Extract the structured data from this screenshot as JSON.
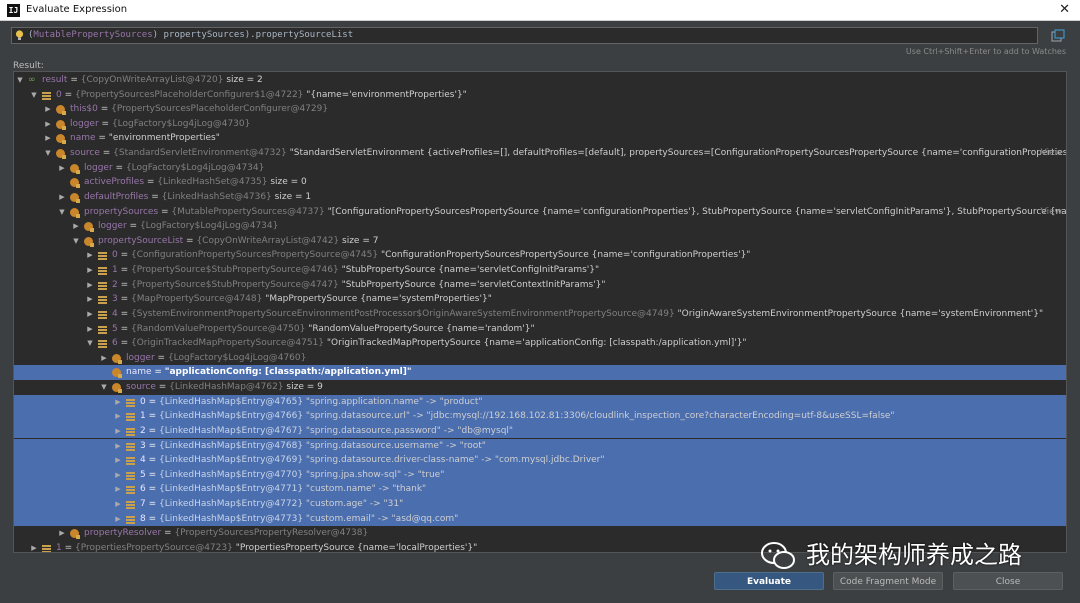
{
  "window": {
    "title": "Evaluate Expression",
    "app_icon": "IJ"
  },
  "expression": {
    "prefix": "(",
    "type": "MutablePropertySources",
    "mid": ") propertySources).propertySourceList"
  },
  "hint": "Use Ctrl+Shift+Enter to add to Watches",
  "result_label": "Result:",
  "tree": [
    {
      "d": 0,
      "tw": "▼",
      "ico": "watch",
      "name": "result",
      "type": "{CopyOnWriteArrayList@4720}",
      "val": "size = 2"
    },
    {
      "d": 1,
      "tw": "▼",
      "ico": "arr",
      "name": "0",
      "type": "{PropertySourcesPlaceholderConfigurer$1@4722}",
      "val": "\"{name='environmentProperties'}\""
    },
    {
      "d": 2,
      "tw": "▶",
      "ico": "field",
      "name": "this$0",
      "type": "{PropertySourcesPlaceholderConfigurer@4729}",
      "val": ""
    },
    {
      "d": 2,
      "tw": "▶",
      "ico": "field",
      "name": "logger",
      "type": "{LogFactory$Log4jLog@4730}",
      "val": ""
    },
    {
      "d": 2,
      "tw": "▶",
      "ico": "field",
      "name": "name",
      "type": "",
      "val": "\"environmentProperties\""
    },
    {
      "d": 2,
      "tw": "▼",
      "ico": "field",
      "name": "source",
      "type": "{StandardServletEnvironment@4732}",
      "val": "\"StandardServletEnvironment {activeProfiles=[], defaultProfiles=[default], propertySources=[ConfigurationPropertySourcesPropertySource {name='configurationProperties'}, StubPropertySource...",
      "view": "View"
    },
    {
      "d": 3,
      "tw": "▶",
      "ico": "field",
      "name": "logger",
      "type": "{LogFactory$Log4jLog@4734}",
      "val": ""
    },
    {
      "d": 3,
      "tw": "",
      "ico": "field",
      "name": "activeProfiles",
      "type": "{LinkedHashSet@4735}",
      "val": "size = 0"
    },
    {
      "d": 3,
      "tw": "▶",
      "ico": "field",
      "name": "defaultProfiles",
      "type": "{LinkedHashSet@4736}",
      "val": "size = 1"
    },
    {
      "d": 3,
      "tw": "▼",
      "ico": "field",
      "name": "propertySources",
      "type": "{MutablePropertySources@4737}",
      "val": "\"[ConfigurationPropertySourcesPropertySource {name='configurationProperties'}, StubPropertySource {name='servletConfigInitParams'}, StubPropertySource {name='servletContextIn...",
      "view": "View"
    },
    {
      "d": 4,
      "tw": "▶",
      "ico": "field",
      "name": "logger",
      "type": "{LogFactory$Log4jLog@4734}",
      "val": ""
    },
    {
      "d": 4,
      "tw": "▼",
      "ico": "field",
      "name": "propertySourceList",
      "type": "{CopyOnWriteArrayList@4742}",
      "val": "size = 7"
    },
    {
      "d": 5,
      "tw": "▶",
      "ico": "arr",
      "name": "0",
      "type": "{ConfigurationPropertySourcesPropertySource@4745}",
      "val": "\"ConfigurationPropertySourcesPropertySource {name='configurationProperties'}\""
    },
    {
      "d": 5,
      "tw": "▶",
      "ico": "arr",
      "name": "1",
      "type": "{PropertySource$StubPropertySource@4746}",
      "val": "\"StubPropertySource {name='servletConfigInitParams'}\""
    },
    {
      "d": 5,
      "tw": "▶",
      "ico": "arr",
      "name": "2",
      "type": "{PropertySource$StubPropertySource@4747}",
      "val": "\"StubPropertySource {name='servletContextInitParams'}\""
    },
    {
      "d": 5,
      "tw": "▶",
      "ico": "arr",
      "name": "3",
      "type": "{MapPropertySource@4748}",
      "val": "\"MapPropertySource {name='systemProperties'}\""
    },
    {
      "d": 5,
      "tw": "▶",
      "ico": "arr",
      "name": "4",
      "type": "{SystemEnvironmentPropertySourceEnvironmentPostProcessor$OriginAwareSystemEnvironmentPropertySource@4749}",
      "val": "\"OriginAwareSystemEnvironmentPropertySource {name='systemEnvironment'}\""
    },
    {
      "d": 5,
      "tw": "▶",
      "ico": "arr",
      "name": "5",
      "type": "{RandomValuePropertySource@4750}",
      "val": "\"RandomValuePropertySource {name='random'}\""
    },
    {
      "d": 5,
      "tw": "▼",
      "ico": "arr",
      "name": "6",
      "type": "{OriginTrackedMapPropertySource@4751}",
      "val": "\"OriginTrackedMapPropertySource {name='applicationConfig: [classpath:/application.yml]'}\""
    },
    {
      "d": 6,
      "tw": "▶",
      "ico": "field",
      "name": "logger",
      "type": "{LogFactory$Log4jLog@4760}",
      "val": ""
    },
    {
      "d": 6,
      "tw": "",
      "ico": "field",
      "name": "name",
      "type": "",
      "val": "\"applicationConfig: [classpath:/application.yml]\"",
      "sel": true,
      "bold": true
    },
    {
      "d": 6,
      "tw": "▼",
      "ico": "field",
      "name": "source",
      "type": "{LinkedHashMap@4762}",
      "val": "size = 9"
    },
    {
      "d": 7,
      "tw": "▶",
      "ico": "arr",
      "name": "0",
      "type": "{LinkedHashMap$Entry@4765}",
      "val": "\"spring.application.name\" -> \"product\"",
      "sel": true
    },
    {
      "d": 7,
      "tw": "▶",
      "ico": "arr",
      "name": "1",
      "type": "{LinkedHashMap$Entry@4766}",
      "val": "\"spring.datasource.url\" -> \"jdbc:mysql://192.168.102.81:3306/cloudlink_inspection_core?characterEncoding=utf-8&useSSL=false\"",
      "sel": true
    },
    {
      "d": 7,
      "tw": "▶",
      "ico": "arr",
      "name": "2",
      "type": "{LinkedHashMap$Entry@4767}",
      "val": "\"spring.datasource.password\" -> \"db@mysql\"",
      "sel": true
    },
    {
      "d": 7,
      "tw": "▶",
      "ico": "arr",
      "name": "3",
      "type": "{LinkedHashMap$Entry@4768}",
      "val": "\"spring.datasource.username\" -> \"root\"",
      "sel": true
    },
    {
      "d": 7,
      "tw": "▶",
      "ico": "arr",
      "name": "4",
      "type": "{LinkedHashMap$Entry@4769}",
      "val": "\"spring.datasource.driver-class-name\" -> \"com.mysql.jdbc.Driver\"",
      "sel": true
    },
    {
      "d": 7,
      "tw": "▶",
      "ico": "arr",
      "name": "5",
      "type": "{LinkedHashMap$Entry@4770}",
      "val": "\"spring.jpa.show-sql\" -> \"true\"",
      "sel": true
    },
    {
      "d": 7,
      "tw": "▶",
      "ico": "arr",
      "name": "6",
      "type": "{LinkedHashMap$Entry@4771}",
      "val": "\"custom.name\" -> \"thank\"",
      "sel": true
    },
    {
      "d": 7,
      "tw": "▶",
      "ico": "arr",
      "name": "7",
      "type": "{LinkedHashMap$Entry@4772}",
      "val": "\"custom.age\" -> \"31\"",
      "sel": true
    },
    {
      "d": 7,
      "tw": "▶",
      "ico": "arr",
      "name": "8",
      "type": "{LinkedHashMap$Entry@4773}",
      "val": "\"custom.email\" -> \"asd@qq.com\"",
      "sel": true
    },
    {
      "d": 3,
      "tw": "▶",
      "ico": "field",
      "name": "propertyResolver",
      "type": "{PropertySourcesPropertyResolver@4738}",
      "val": ""
    },
    {
      "d": 1,
      "tw": "▶",
      "ico": "arr",
      "name": "1",
      "type": "{PropertiesPropertySource@4723}",
      "val": "\"PropertiesPropertySource {name='localProperties'}\""
    }
  ],
  "buttons": {
    "evaluate": "Evaluate",
    "code_fragment": "Code Fragment Mode",
    "close": "Close"
  },
  "watermark": "我的架构师养成之路"
}
